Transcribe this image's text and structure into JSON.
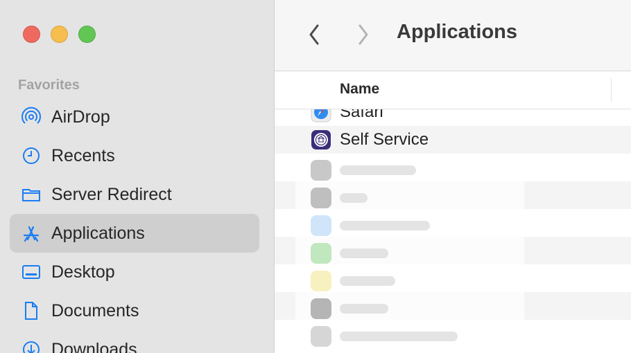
{
  "window": {
    "title": "Applications"
  },
  "sidebar": {
    "section": "Favorites",
    "items": [
      {
        "label": "AirDrop",
        "icon": "airdrop-icon",
        "selected": false
      },
      {
        "label": "Recents",
        "icon": "clock-icon",
        "selected": false
      },
      {
        "label": "Server Redirect",
        "icon": "folder-icon",
        "selected": false
      },
      {
        "label": "Applications",
        "icon": "applications-icon",
        "selected": true
      },
      {
        "label": "Desktop",
        "icon": "desktop-icon",
        "selected": false
      },
      {
        "label": "Documents",
        "icon": "document-icon",
        "selected": false
      },
      {
        "label": "Downloads",
        "icon": "download-icon",
        "selected": false
      }
    ]
  },
  "list": {
    "column_header": "Name",
    "rows": [
      {
        "name": "Safari",
        "icon": "safari-icon"
      },
      {
        "name": "Self Service",
        "icon": "self-service-icon"
      }
    ]
  },
  "colors": {
    "accent": "#1a7cf3",
    "sidebar_bg": "#e4e4e4",
    "selected_bg": "#cfcfcf"
  }
}
